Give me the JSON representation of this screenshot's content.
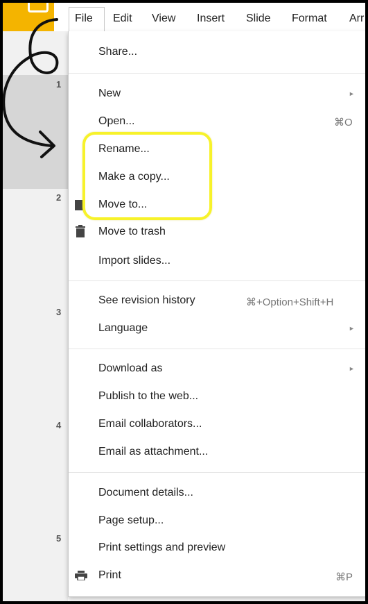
{
  "menubar": {
    "items": [
      "File",
      "Edit",
      "View",
      "Insert",
      "Slide",
      "Format",
      "Arr"
    ]
  },
  "slides": {
    "numbers": [
      "1",
      "2",
      "3",
      "4",
      "5"
    ]
  },
  "file_menu": {
    "share": "Share...",
    "new": "New",
    "open": "Open...",
    "open_shortcut": "⌘O",
    "rename": "Rename...",
    "make_copy": "Make a copy...",
    "move_to": "Move to...",
    "move_to_trash": "Move to trash",
    "import_slides": "Import slides...",
    "revision_history": "See revision history",
    "revision_shortcut": "⌘+Option+Shift+H",
    "language": "Language",
    "download_as": "Download as",
    "publish": "Publish to the web...",
    "email_collaborators": "Email collaborators...",
    "email_attachment": "Email as attachment...",
    "document_details": "Document details...",
    "page_setup": "Page setup...",
    "print_settings": "Print settings and preview",
    "print": "Print",
    "print_shortcut": "⌘P",
    "submenu_arrow": "►"
  },
  "colors": {
    "highlight": "#f7f22a",
    "logo": "#f4b400"
  }
}
